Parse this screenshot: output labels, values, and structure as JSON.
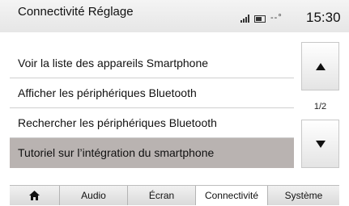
{
  "header": {
    "title": "Connectivité Réglage",
    "temperature": "--°",
    "time": "15:30"
  },
  "list": {
    "items": [
      {
        "label": "Voir la liste des appareils Smartphone",
        "selected": false
      },
      {
        "label": "Afficher les périphériques Bluetooth",
        "selected": false
      },
      {
        "label": "Rechercher les périphériques Bluetooth",
        "selected": false
      },
      {
        "label": "Tutoriel sur l’intégration du smartphone",
        "selected": true
      }
    ],
    "page_indicator": "1/2"
  },
  "tabs": {
    "items": [
      {
        "label": "",
        "icon": "home-icon",
        "active": false
      },
      {
        "label": "Audio",
        "active": false
      },
      {
        "label": "Écran",
        "active": false
      },
      {
        "label": "Connectivité",
        "active": true
      },
      {
        "label": "Système",
        "active": false
      }
    ]
  },
  "colors": {
    "selected_row": "#b9b3b1",
    "header_bg": "#eeeeee"
  }
}
